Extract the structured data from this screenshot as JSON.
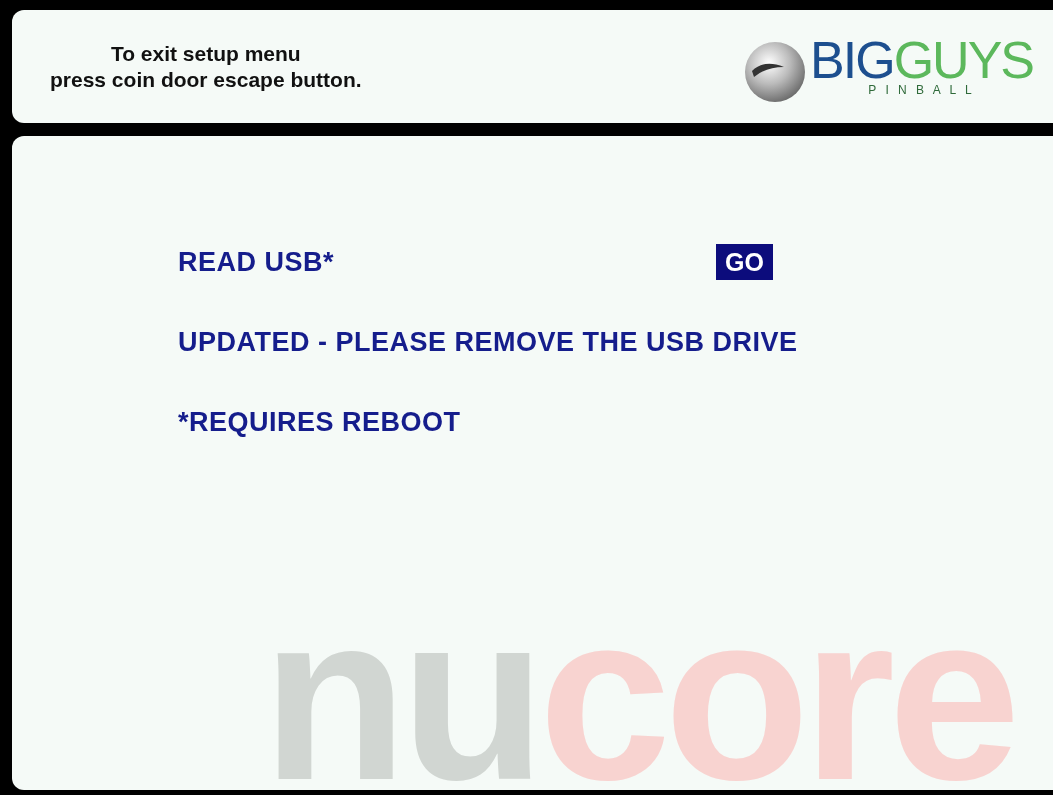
{
  "header": {
    "instructions": [
      "To exit setup menu",
      "press coin door escape button."
    ],
    "logo": {
      "word_1": "BIG",
      "word_2": "GUYS",
      "tagline": "P I N B A L L"
    }
  },
  "rows": [
    {
      "kind": "action",
      "label": "READ USB*",
      "button": "GO"
    },
    {
      "kind": "text",
      "label": "UPDATED - PLEASE REMOVE THE USB DRIVE"
    },
    {
      "kind": "text",
      "label": "*REQUIRES REBOOT"
    }
  ],
  "brand": {
    "part_1": "nu",
    "part_2": "core"
  }
}
